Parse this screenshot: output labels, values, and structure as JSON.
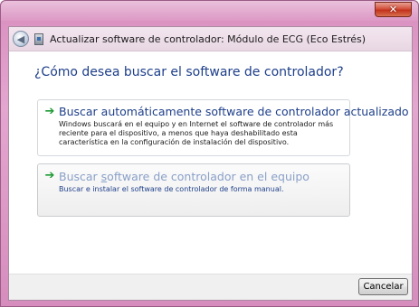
{
  "window": {
    "title": "Actualizar software de controlador: Módulo de ECG (Eco Estrés)",
    "close_glyph": "✕"
  },
  "heading": "¿Cómo desea buscar el software de controlador?",
  "options": [
    {
      "icon": "green-arrow-icon",
      "title": "Buscar automáticamente software de controlador actualizado",
      "description": "Windows buscará en el equipo y en Internet el software de controlador más reciente para el dispositivo, a menos que haya deshabilitado esta característica en la configuración de instalación del dispositivo."
    },
    {
      "icon": "green-arrow-icon",
      "title_pre": "Buscar ",
      "title_accel": "s",
      "title_post": "oftware de controlador en el equipo",
      "description": "Buscar e instalar el software de controlador de forma manual."
    }
  ],
  "footer": {
    "cancel_label": "Cancelar"
  },
  "colors": {
    "frame": "#e3a6cf",
    "heading": "#1e3f8a",
    "arrow": "#1e9a35"
  }
}
